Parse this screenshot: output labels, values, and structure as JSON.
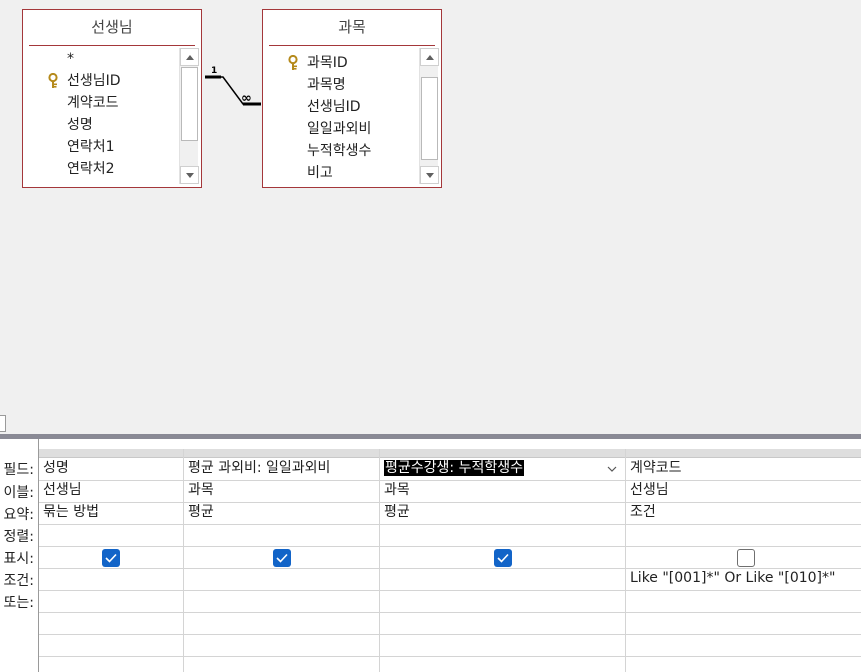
{
  "tables": [
    {
      "title": "선생님",
      "fields": [
        {
          "name": "*",
          "is_key": false
        },
        {
          "name": "선생님ID",
          "is_key": true
        },
        {
          "name": "계약코드",
          "is_key": false
        },
        {
          "name": "성명",
          "is_key": false
        },
        {
          "name": "연락처1",
          "is_key": false
        },
        {
          "name": "연락처2",
          "is_key": false
        }
      ]
    },
    {
      "title": "과목",
      "fields": [
        {
          "name": "과목ID",
          "is_key": true
        },
        {
          "name": "과목명",
          "is_key": false
        },
        {
          "name": "선생님ID",
          "is_key": false
        },
        {
          "name": "일일과외비",
          "is_key": false
        },
        {
          "name": "누적학생수",
          "is_key": false
        },
        {
          "name": "비고",
          "is_key": false
        }
      ]
    }
  ],
  "relationship": {
    "one_label": "1",
    "many_label": "∞"
  },
  "grid": {
    "row_labels": [
      "필드:",
      "이블:",
      "요약:",
      "정렬:",
      "표시:",
      "조건:",
      "또는:"
    ],
    "columns": [
      {
        "field": "성명",
        "table": "선생님",
        "total": "묶는 방법",
        "sort": "",
        "show": true,
        "criteria": "",
        "or": ""
      },
      {
        "field": "평균 과외비: 일일과외비",
        "table": "과목",
        "total": "평균",
        "sort": "",
        "show": true,
        "criteria": "",
        "or": ""
      },
      {
        "field": "평균수강생: 누적학생수",
        "table": "과목",
        "total": "평균",
        "sort": "",
        "show": true,
        "criteria": "",
        "or": "",
        "selected": true
      },
      {
        "field": "계약코드",
        "table": "선생님",
        "total": "조건",
        "sort": "",
        "show": false,
        "criteria": "Like \"[001]*\" Or Like \"[010]*\"",
        "or": ""
      }
    ]
  },
  "colors": {
    "table_border": "#a4373a",
    "checkbox_on": "#1264c8",
    "splitter": "#8a8a95"
  }
}
